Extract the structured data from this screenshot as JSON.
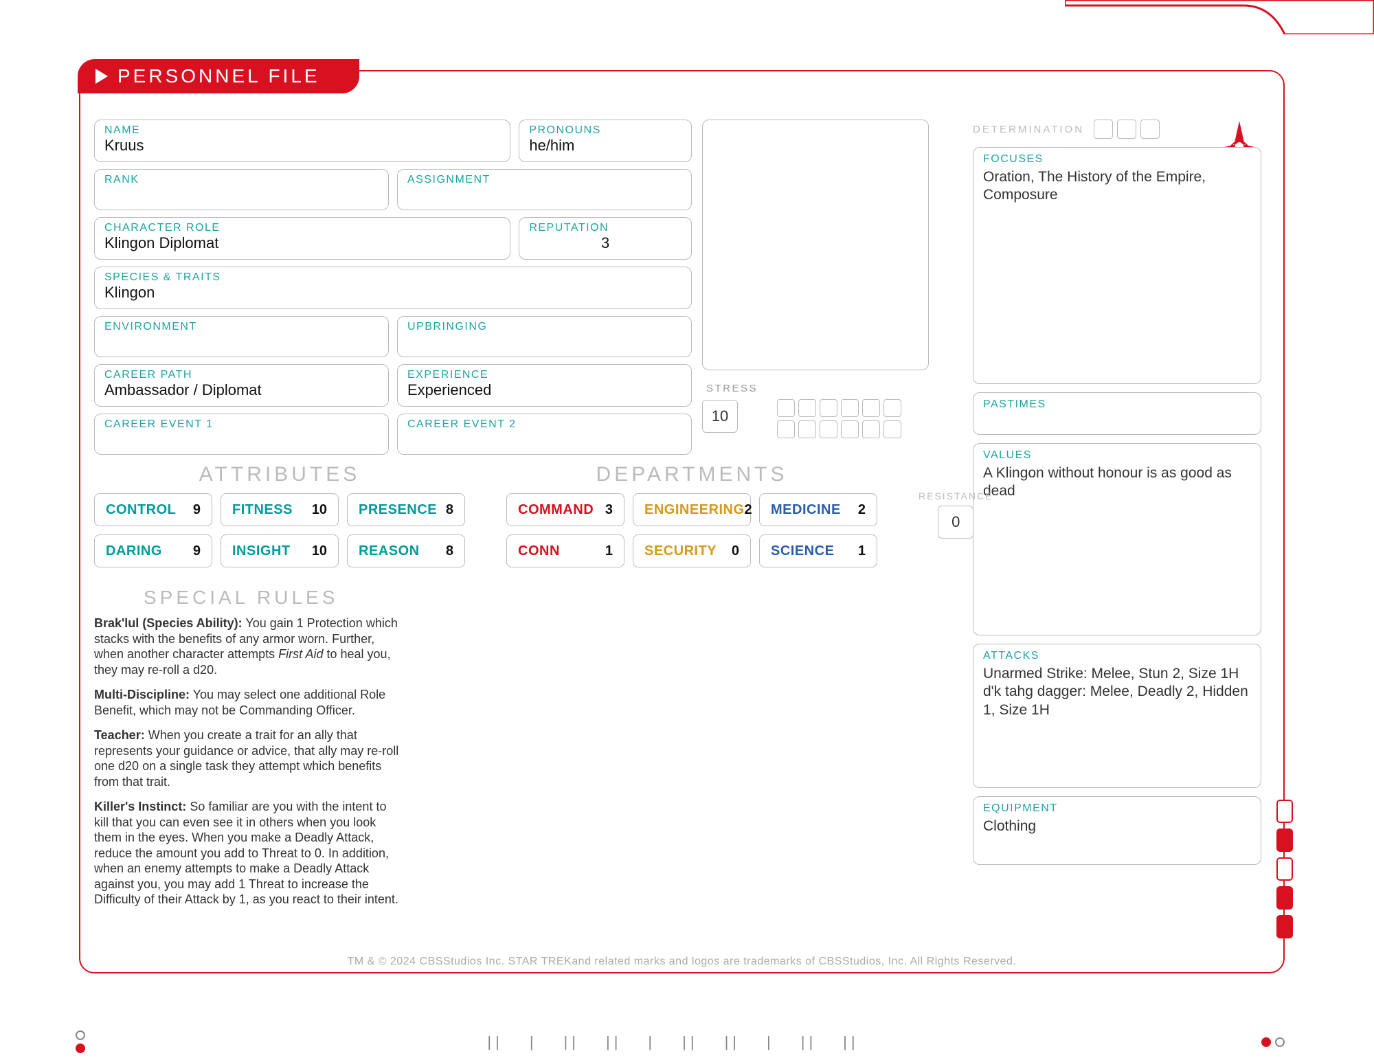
{
  "header": {
    "title": "PERSONNEL FILE"
  },
  "labels": {
    "name": "NAME",
    "pronouns": "PRONOUNS",
    "rank": "RANK",
    "assignment": "ASSIGNMENT",
    "char_role": "CHARACTER ROLE",
    "reputation": "REPUTATION",
    "species_traits": "SPECIES & TRAITS",
    "environment": "ENVIRONMENT",
    "upbringing": "UPBRINGING",
    "career_path": "CAREER PATH",
    "experience": "EXPERIENCE",
    "career_event_1": "CAREER EVENT 1",
    "career_event_2": "CAREER EVENT 2",
    "stress": "STRESS",
    "determination": "DETERMINATION",
    "focuses": "FOCUSES",
    "pastimes": "PASTIMES",
    "values": "VALUES",
    "attacks": "ATTACKS",
    "equipment": "EQUIPMENT",
    "attributes": "ATTRIBUTES",
    "departments": "DEPARTMENTS",
    "resistance": "RESISTANCE",
    "special_rules": "SPECIAL RULES"
  },
  "fields": {
    "name": "Kruus",
    "pronouns": "he/him",
    "rank": "",
    "assignment": "",
    "char_role": "Klingon Diplomat",
    "reputation": "3",
    "species_traits": "Klingon",
    "environment": "",
    "upbringing": "",
    "career_path": "Ambassador / Diplomat",
    "experience": "Experienced",
    "career_event_1": "",
    "career_event_2": ""
  },
  "stress": "10",
  "resistance": "0",
  "attributes": [
    {
      "name": "CONTROL",
      "value": 9
    },
    {
      "name": "FITNESS",
      "value": 10
    },
    {
      "name": "PRESENCE",
      "value": 8
    },
    {
      "name": "DARING",
      "value": 9
    },
    {
      "name": "INSIGHT",
      "value": 10
    },
    {
      "name": "REASON",
      "value": 8
    }
  ],
  "departments": [
    {
      "name": "COMMAND",
      "value": 3,
      "color": "c-red"
    },
    {
      "name": "ENGINEERING",
      "value": 2,
      "color": "c-gold"
    },
    {
      "name": "MEDICINE",
      "value": 2,
      "color": "c-blue"
    },
    {
      "name": "CONN",
      "value": 1,
      "color": "c-red"
    },
    {
      "name": "SECURITY",
      "value": 0,
      "color": "c-gold"
    },
    {
      "name": "SCIENCE",
      "value": 1,
      "color": "c-blue"
    }
  ],
  "focuses": "Oration, The History of the Empire, Composure",
  "pastimes": "",
  "values": "A Klingon without honour is as good as dead",
  "attacks": "Unarmed Strike: Melee, Stun 2, Size 1H\nd'k tahg dagger: Melee, Deadly 2, Hidden 1, Size 1H",
  "equipment": "Clothing",
  "special_rules": [
    {
      "name": "Brak'lul (Species Ability):",
      "text": "You gain 1 Protection which stacks with the benefits of any armor worn. Further, when another character attempts ",
      "ital": "First Aid",
      "text2": " to heal you, they may re-roll a d20."
    },
    {
      "name": "Multi-Discipline:",
      "text": "You may select one additional Role Benefit, which may not be Commanding Officer."
    },
    {
      "name": "Teacher:",
      "text": "When you create a trait for an ally that represents your guidance or advice, that ally may re-roll one d20 on a single task they attempt which benefits from that trait."
    },
    {
      "name": "Killer's Instinct:",
      "text": "So familiar are you with the intent to kill that you can even see it in others when you look them in the eyes. When you make a Deadly Attack, reduce the amount you add to Threat to 0. In addition, when an enemy attempts to make a Deadly Attack against you, you may add 1 Threat to increase the Difficulty of their Attack by 1, as you react to their intent."
    }
  ],
  "footer": "TM & © 2024 CBSStudios Inc. STAR TREKand related marks and logos are trademarks of CBSStudios, Inc. All Rights Reserved."
}
